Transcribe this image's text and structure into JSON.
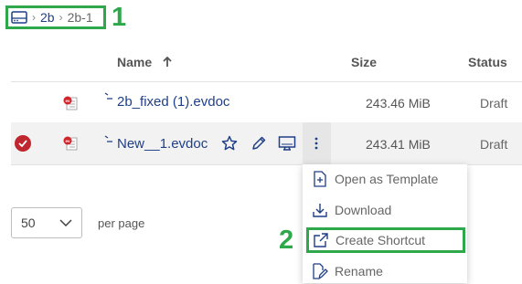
{
  "breadcrumb": {
    "items": [
      "2b",
      "2b-1"
    ]
  },
  "callouts": [
    "1",
    "2"
  ],
  "table": {
    "headers": {
      "name": "Name",
      "size": "Size",
      "status": "Status"
    },
    "rows": [
      {
        "name": "2b_fixed (1).evdoc",
        "size": "243.46 MiB",
        "status": "Draft",
        "selected": false
      },
      {
        "name": "New__1.evdoc",
        "size": "243.41 MiB",
        "status": "Draft",
        "selected": true
      }
    ]
  },
  "pagination": {
    "per_page_value": "50",
    "per_page_label": "per page"
  },
  "context_menu": {
    "items": [
      {
        "label": "Open as Template",
        "icon": "template-icon"
      },
      {
        "label": "Download",
        "icon": "download-icon"
      },
      {
        "label": "Create Shortcut",
        "icon": "external-link-icon",
        "highlighted": true
      },
      {
        "label": "Rename",
        "icon": "rename-icon"
      }
    ]
  },
  "colors": {
    "accent": "#1f3f87",
    "callout": "#2ea84a",
    "check": "#c0262d"
  }
}
